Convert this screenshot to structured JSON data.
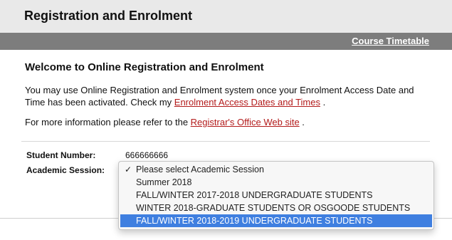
{
  "header": {
    "title": "Registration and Enrolment"
  },
  "nav": {
    "course_timetable": "Course Timetable"
  },
  "welcome": {
    "heading": "Welcome to Online Registration and Enrolment",
    "para1_prefix": "You may use Online Registration and Enrolment system once your Enrolment Access Date and Time has been activated. Check my ",
    "para1_link": "Enrolment Access Dates and Times",
    "para1_suffix": " .",
    "para2_prefix": "For more information please refer to the ",
    "para2_link": "Registrar's Office Web site",
    "para2_suffix": " ."
  },
  "form": {
    "student_number_label": "Student Number:",
    "student_number_value": "666666666",
    "academic_session_label": "Academic Session:",
    "options": [
      "Please select Academic Session",
      "Summer 2018",
      "FALL/WINTER 2017-2018 UNDERGRADUATE STUDENTS",
      "WINTER 2018-GRADUATE STUDENTS OR OSGOODE STUDENTS",
      "FALL/WINTER 2018-2019 UNDERGRADUATE STUDENTS"
    ],
    "checkmark": "✓"
  }
}
